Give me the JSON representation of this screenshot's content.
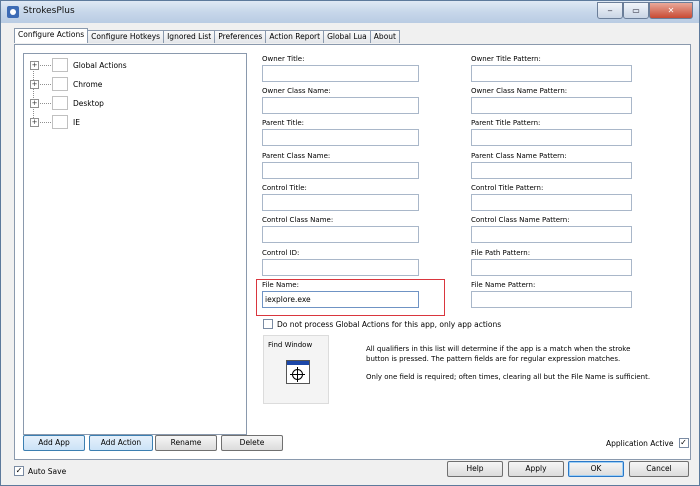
{
  "window": {
    "title": "StrokesPlus"
  },
  "tabs": [
    "Configure Actions",
    "Configure Hotkeys",
    "Ignored List",
    "Preferences",
    "Action Report",
    "Global Lua",
    "About"
  ],
  "tree": {
    "items": [
      "Global Actions",
      "Chrome",
      "Desktop",
      "IE"
    ],
    "expander": "+"
  },
  "fields": {
    "owner_title": {
      "label": "Owner Title:",
      "value": ""
    },
    "owner_title_pattern": {
      "label": "Owner Title Pattern:",
      "value": ""
    },
    "owner_class_name": {
      "label": "Owner Class Name:",
      "value": ""
    },
    "owner_class_name_pattern": {
      "label": "Owner Class Name Pattern:",
      "value": ""
    },
    "parent_title": {
      "label": "Parent Title:",
      "value": ""
    },
    "parent_title_pattern": {
      "label": "Parent Title Pattern:",
      "value": ""
    },
    "parent_class_name": {
      "label": "Parent Class Name:",
      "value": ""
    },
    "parent_class_name_pattern": {
      "label": "Parent Class Name Pattern:",
      "value": ""
    },
    "control_title": {
      "label": "Control Title:",
      "value": ""
    },
    "control_title_pattern": {
      "label": "Control Title Pattern:",
      "value": ""
    },
    "control_class_name": {
      "label": "Control Class Name:",
      "value": ""
    },
    "control_class_name_pattern": {
      "label": "Control Class Name Pattern:",
      "value": ""
    },
    "control_id": {
      "label": "Control ID:",
      "value": ""
    },
    "file_path_pattern": {
      "label": "File Path Pattern:",
      "value": ""
    },
    "file_name": {
      "label": "File Name:",
      "value": "iexplore.exe"
    },
    "file_name_pattern": {
      "label": "File Name Pattern:",
      "value": ""
    }
  },
  "skip_global": {
    "label": "Do not process Global Actions for this app, only app actions",
    "checked": false
  },
  "find_window": {
    "label": "Find Window",
    "icon": "crosshair-icon"
  },
  "info": {
    "p1": "All qualifiers in this list will determine if the app is a match when the stroke button is pressed. The pattern fields are for regular expression matches.",
    "p2": "Only one field is required; often times, clearing all but the File Name is sufficient."
  },
  "buttons": {
    "add_app": "Add App",
    "add_action": "Add Action",
    "rename": "Rename",
    "delete": "Delete",
    "help": "Help",
    "apply": "Apply",
    "ok": "OK",
    "cancel": "Cancel"
  },
  "application_active": {
    "label": "Application Active",
    "checked": true,
    "mark": "✓"
  },
  "auto_save": {
    "label": "Auto Save",
    "checked": true,
    "mark": "✓"
  },
  "window_controls": {
    "minimize": "‒",
    "maximize": "▭",
    "close": "✕"
  },
  "colors": {
    "highlight": "#d9363e",
    "accent": "#3c7fb1"
  }
}
